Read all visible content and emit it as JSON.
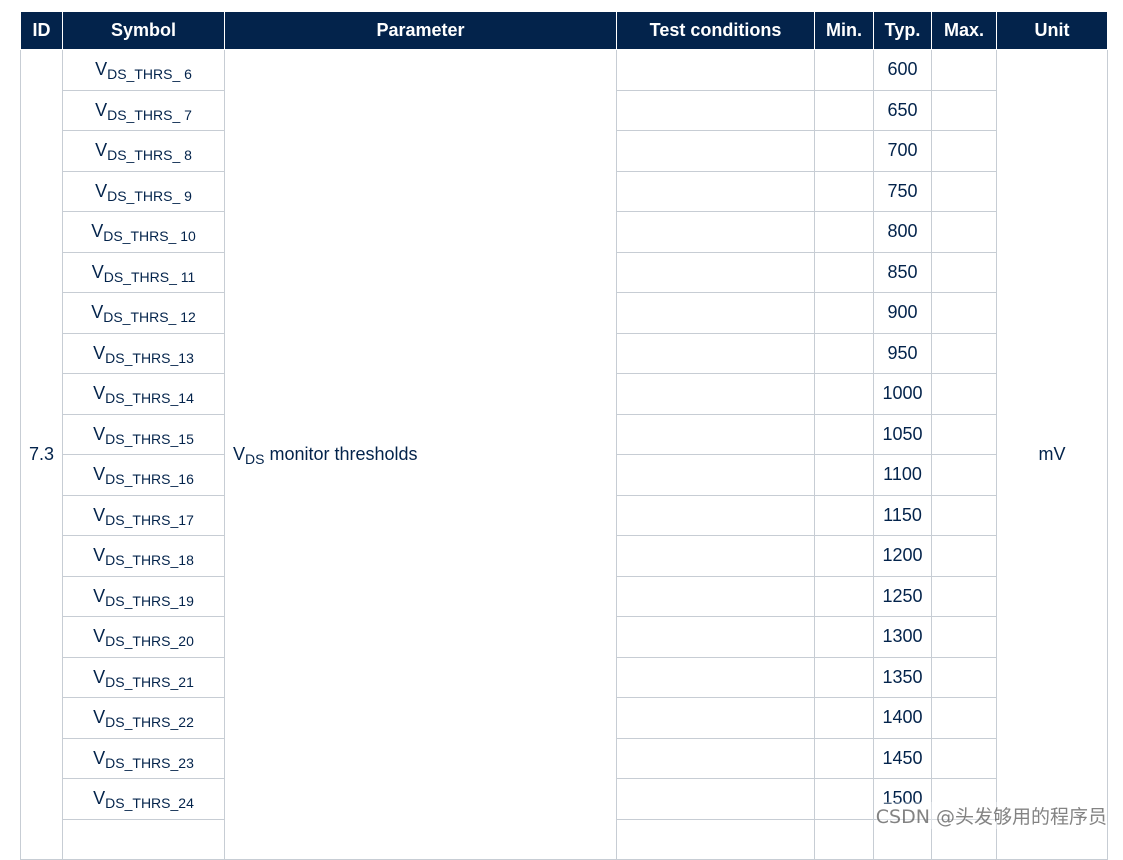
{
  "headers": {
    "id": "ID",
    "symbol": "Symbol",
    "parameter": "Parameter",
    "test_conditions": "Test conditions",
    "min": "Min.",
    "typ": "Typ.",
    "max": "Max.",
    "unit": "Unit"
  },
  "group": {
    "id": "7.3",
    "parameter_main": "V",
    "parameter_sub": "DS",
    "parameter_rest": " monitor thresholds",
    "unit": "mV"
  },
  "rows": [
    {
      "sym_main": "V",
      "sym_sub": "DS_THRS_ 6",
      "typ": "600"
    },
    {
      "sym_main": "V",
      "sym_sub": "DS_THRS_ 7",
      "typ": "650"
    },
    {
      "sym_main": "V",
      "sym_sub": "DS_THRS_ 8",
      "typ": "700"
    },
    {
      "sym_main": "V",
      "sym_sub": "DS_THRS_ 9",
      "typ": "750"
    },
    {
      "sym_main": "V",
      "sym_sub": "DS_THRS_ 10",
      "typ": "800"
    },
    {
      "sym_main": "V",
      "sym_sub": "DS_THRS_ 11",
      "typ": "850"
    },
    {
      "sym_main": "V",
      "sym_sub": "DS_THRS_ 12",
      "typ": "900"
    },
    {
      "sym_main": "V",
      "sym_sub": "DS_THRS_13",
      "typ": "950"
    },
    {
      "sym_main": "V",
      "sym_sub": "DS_THRS_14",
      "typ": "1000"
    },
    {
      "sym_main": "V",
      "sym_sub": "DS_THRS_15",
      "typ": "1050"
    },
    {
      "sym_main": "V",
      "sym_sub": "DS_THRS_16",
      "typ": "1100"
    },
    {
      "sym_main": "V",
      "sym_sub": "DS_THRS_17",
      "typ": "1150"
    },
    {
      "sym_main": "V",
      "sym_sub": "DS_THRS_18",
      "typ": "1200"
    },
    {
      "sym_main": "V",
      "sym_sub": "DS_THRS_19",
      "typ": "1250"
    },
    {
      "sym_main": "V",
      "sym_sub": "DS_THRS_20",
      "typ": "1300"
    },
    {
      "sym_main": "V",
      "sym_sub": "DS_THRS_21",
      "typ": "1350"
    },
    {
      "sym_main": "V",
      "sym_sub": "DS_THRS_22",
      "typ": "1400"
    },
    {
      "sym_main": "V",
      "sym_sub": "DS_THRS_23",
      "typ": "1450"
    },
    {
      "sym_main": "V",
      "sym_sub": "DS_THRS_24",
      "typ": "1500"
    }
  ],
  "watermark": "CSDN @头发够用的程序员",
  "colors": {
    "header_bg": "#03234b",
    "header_text": "#ffffff",
    "body_text": "#03234b",
    "grid": "#c7cdd4"
  }
}
